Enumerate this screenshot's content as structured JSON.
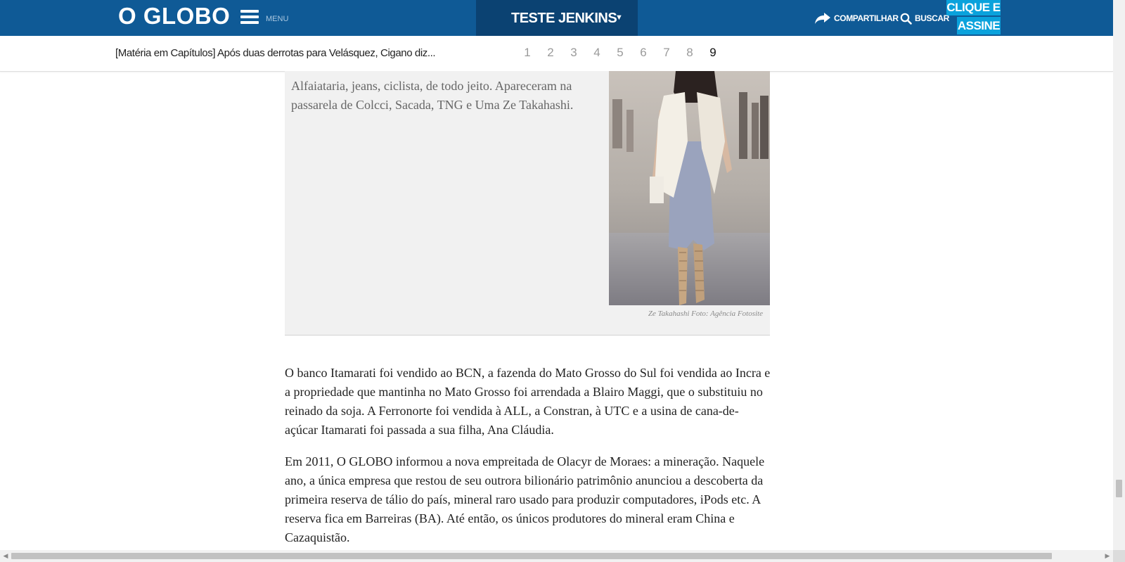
{
  "header": {
    "logo": "O GLOBO",
    "menu_label": "MENU",
    "section_title": "TESTE JENKINS",
    "section_caret": "▼",
    "share_label": "COMPARTILHAR",
    "search_label": "BUSCAR",
    "subscribe_line1": "CLIQUE E",
    "subscribe_line2": "ASSINE",
    "colors": {
      "bar": "#0f5a96",
      "section": "#0b4272",
      "subscribe": "#0aa2dc"
    },
    "icons": [
      "hamburger-icon",
      "share-arrow-icon",
      "search-icon",
      "chevron-down-icon"
    ]
  },
  "chapter_bar": {
    "title": "[Matéria em Capítulos] Após duas derrotas para Velásquez, Cigano diz...",
    "pages": [
      "1",
      "2",
      "3",
      "4",
      "5",
      "6",
      "7",
      "8",
      "9"
    ],
    "current_page": "9"
  },
  "figure": {
    "text": "Alfaiataria, jeans, ciclista, de todo jeito. Apareceram na passarela de Colcci, Sacada, TNG e Uma Ze Takahashi.",
    "photo_credit": "Ze Takahashi Foto: Agência Fotosite"
  },
  "article": {
    "paragraphs": [
      "O banco Itamarati foi vendido ao BCN, a fazenda do Mato Grosso do Sul foi vendida ao Incra e a propriedade que mantinha no Mato Grosso foi arrendada a Blairo Maggi, que o substituiu no reinado da soja. A Ferronorte foi vendida à ALL, a Constran, à UTC e a usina de cana-de-açúcar Itamarati foi passada a sua filha, Ana Cláudia.",
      "Em 2011, O GLOBO informou a nova empreitada de Olacyr de Moraes: a mineração. Naquele ano, a única empresa que restou de seu outrora bilionário patrimônio anunciou a descoberta da primeira reserva de tálio do país, mineral raro usado para produzir computadores, iPods etc. A reserva fica em Barreiras (BA). Até então, os únicos produtores do mineral eram China e Cazaquistão."
    ]
  }
}
